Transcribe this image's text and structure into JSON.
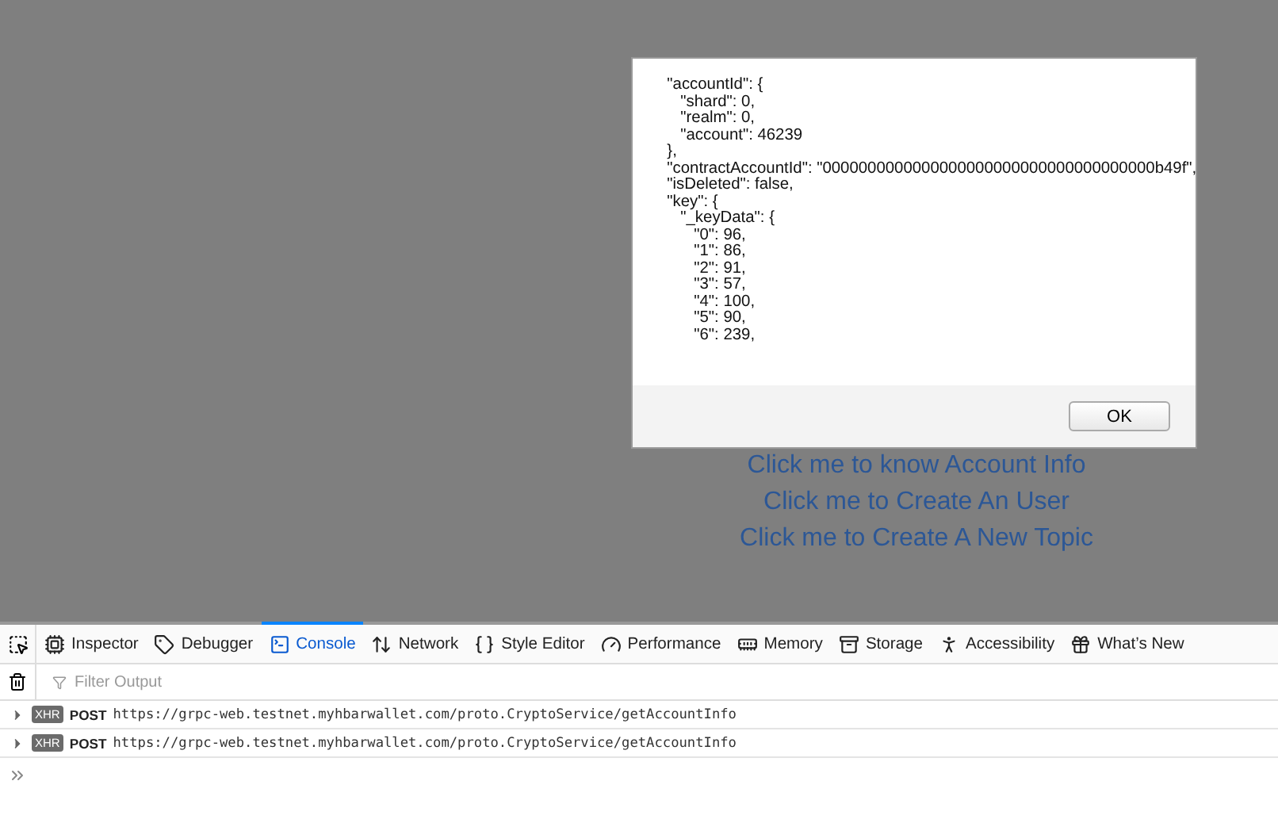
{
  "dialog": {
    "message": "  \"accountId\": {\n     \"shard\": 0,\n     \"realm\": 0,\n     \"account\": 46239\n  },\n  \"contractAccountId\": \"0000000000000000000000000000000000000b49f\",\n  \"isDeleted\": false,\n  \"key\": {\n     \"_keyData\": {\n        \"0\": 96,\n        \"1\": 86,\n        \"2\": 91,\n        \"3\": 57,\n        \"4\": 100,\n        \"5\": 90,\n        \"6\": 239,",
    "button": "OK"
  },
  "links": [
    "Click me to know Account Info",
    "Click me to Create An User",
    "Click me to Create A New Topic"
  ],
  "devtools": {
    "tabs": [
      {
        "label": "Inspector",
        "selected": false
      },
      {
        "label": "Debugger",
        "selected": false
      },
      {
        "label": "Console",
        "selected": true
      },
      {
        "label": "Network",
        "selected": false
      },
      {
        "label": "Style Editor",
        "selected": false
      },
      {
        "label": "Performance",
        "selected": false
      },
      {
        "label": "Memory",
        "selected": false
      },
      {
        "label": "Storage",
        "selected": false
      },
      {
        "label": "Accessibility",
        "selected": false
      },
      {
        "label": "What’s New",
        "selected": false
      }
    ],
    "filter": {
      "placeholder": "Filter Output"
    },
    "messages": [
      {
        "badge": "XHR",
        "method": "POST",
        "url": "https://grpc-web.testnet.myhbarwallet.com/proto.CryptoService/getAccountInfo"
      },
      {
        "badge": "XHR",
        "method": "POST",
        "url": "https://grpc-web.testnet.myhbarwallet.com/proto.CryptoService/getAccountInfo"
      }
    ]
  }
}
